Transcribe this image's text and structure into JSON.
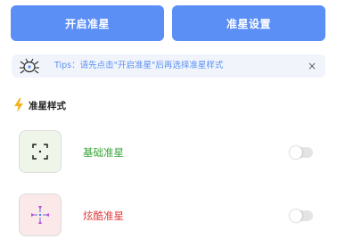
{
  "header": {
    "start_button_label": "开启准星",
    "settings_button_label": "准星设置"
  },
  "tips": {
    "text": "Tips：请先点击\"开启准星\"后再选择准星样式",
    "close_symbol": "×"
  },
  "section": {
    "title": "准星样式"
  },
  "styles": [
    {
      "label": "基础准星",
      "label_color": "#3aa53a",
      "icon": "basic-crosshair-icon",
      "enabled": false
    },
    {
      "label": "炫酷准星",
      "label_color": "#e03b3b",
      "icon": "cool-crosshair-icon",
      "enabled": false
    }
  ],
  "colors": {
    "primary": "#5b8ff5",
    "tips_background": "#f1f5fb",
    "toggle_off": "#e4e4e4"
  }
}
